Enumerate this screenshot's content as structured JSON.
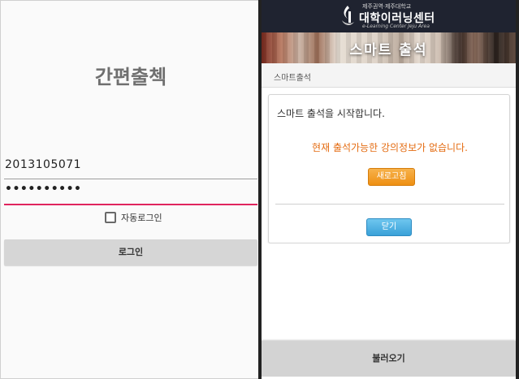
{
  "login": {
    "title": "간편출첵",
    "student_id_value": "2013105071",
    "password_masked": "••••••••••",
    "auto_login_label": "자동로그인",
    "auto_login_checked": false,
    "login_button": "로그인"
  },
  "attendance": {
    "header": {
      "logo_small": "제주권역·제주대학교",
      "logo_main": "대학이러닝센터",
      "logo_sub": "e-Learning Center Jeju Area"
    },
    "banner_title": "스마트 출석",
    "breadcrumb": "스마트출석",
    "card": {
      "heading": "스마트 출석을 시작합니다.",
      "notice": "현재 출석가능한 강의정보가 없습니다.",
      "refresh_button": "새로고침",
      "close_button": "닫기"
    },
    "load_button": "불러오기"
  },
  "colors": {
    "password_underline": "#e0245e",
    "notice_text": "#e46c12",
    "refresh_button": "#f0991f",
    "close_button": "#3aa1d8",
    "header_bg": "#1f2330"
  }
}
